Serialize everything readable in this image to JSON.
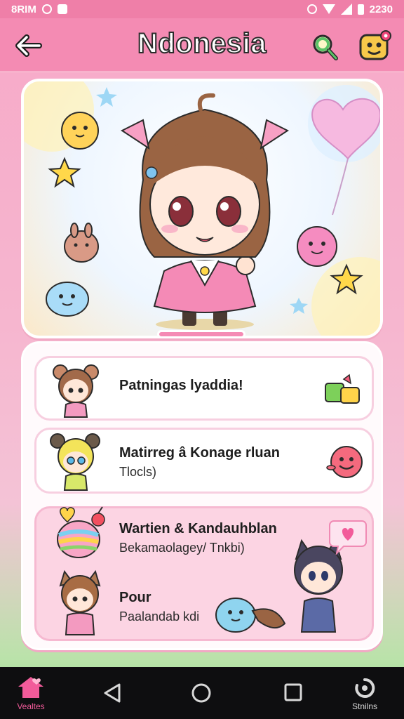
{
  "status_bar": {
    "left_text": "8RIM",
    "time": "2230",
    "icons": [
      "settings-icon",
      "box-icon",
      "vibrate-icon",
      "wifi-icon",
      "signal-icon",
      "battery-icon"
    ]
  },
  "header": {
    "title": "Ndonesia",
    "back_icon": "arrow-left-icon",
    "search_icon": "search-icon",
    "profile_icon": "profile-icon",
    "colors": {
      "bar": "#f48bb3",
      "title_fill": "#ffffff",
      "title_stroke": "#2b2b2b"
    }
  },
  "list": {
    "items": [
      {
        "title": "Patningas lyaddia!",
        "subtitle": "",
        "icon": "gift-icon"
      },
      {
        "title": "Matirreg â Konage rluan",
        "subtitle": "Tlocls)",
        "icon": "smiley-ball-icon"
      },
      {
        "title": "Wartien & Kandauhblan",
        "subtitle": "Bekamaolagey/ Tnkbi)",
        "icon": "lollipop-icon"
      },
      {
        "title": "Pour",
        "subtitle": "Paalandab kdi",
        "icon": "speech-heart-icon"
      }
    ]
  },
  "nav": {
    "items": [
      {
        "label": "Vealtes",
        "icon": "home-icon",
        "active": true
      },
      {
        "label": "",
        "icon": "back-triangle-icon",
        "active": false
      },
      {
        "label": "",
        "icon": "home-circle-icon",
        "active": false
      },
      {
        "label": "",
        "icon": "recents-square-icon",
        "active": false
      },
      {
        "label": "Stnilns",
        "icon": "stats-icon",
        "active": false
      }
    ],
    "colors": {
      "active": "#f25b9a",
      "inactive": "#d8d8d8"
    }
  }
}
